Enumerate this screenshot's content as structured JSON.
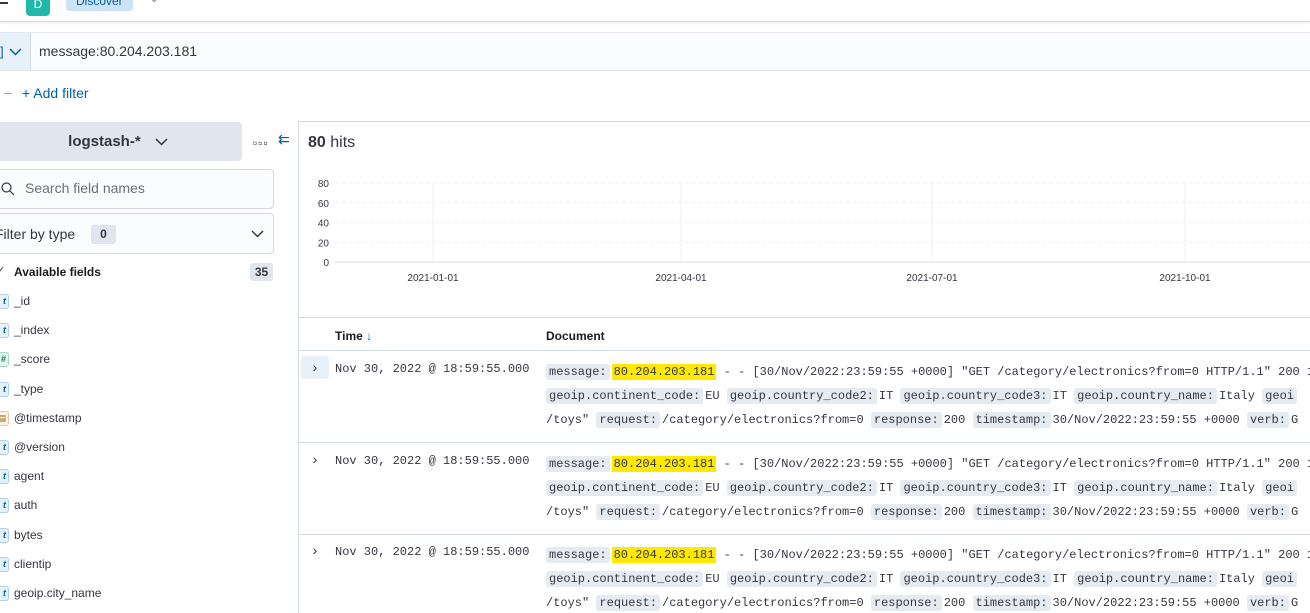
{
  "header": {
    "app_initial": "D",
    "breadcrumb": "Discover"
  },
  "query": {
    "text": "message:80.204.203.181"
  },
  "filters": {
    "add_label": "+ Add filter"
  },
  "sidebar": {
    "index_pattern": "logstash-*",
    "search_placeholder": "Search field names",
    "filter_by_type_label": "Filter by type",
    "filter_by_type_count": "0",
    "available_fields_label": "Available fields",
    "available_fields_count": "35",
    "fields": [
      {
        "name": "_id",
        "type": "t"
      },
      {
        "name": "_index",
        "type": "t"
      },
      {
        "name": "_score",
        "type": "#"
      },
      {
        "name": "_type",
        "type": "t"
      },
      {
        "name": "@timestamp",
        "type": "date"
      },
      {
        "name": "@version",
        "type": "t"
      },
      {
        "name": "agent",
        "type": "t"
      },
      {
        "name": "auth",
        "type": "t"
      },
      {
        "name": "bytes",
        "type": "t"
      },
      {
        "name": "clientip",
        "type": "t"
      },
      {
        "name": "geoip.city_name",
        "type": "t"
      }
    ]
  },
  "main": {
    "hits_count": "80",
    "hits_label": "hits",
    "columns": {
      "time": "Time",
      "time_sort": "↓",
      "document": "Document"
    }
  },
  "chart_data": {
    "type": "bar",
    "y_ticks": [
      "80",
      "60",
      "40",
      "20",
      "0"
    ],
    "ylim": [
      0,
      80
    ],
    "x_ticks": [
      "2021-01-01",
      "2021-04-01",
      "2021-07-01",
      "2021-10-01"
    ],
    "grid": true,
    "values": []
  },
  "rows": [
    {
      "time": "Nov 30, 2022 @ 18:59:55.000",
      "message_key": "message:",
      "message_ip": "80.204.203.181",
      "message_rest": " - - [30/Nov/2022:23:59:55 +0000] \"GET /category/electronics?from=0 HTTP/1.1\" 200 1",
      "continent_key": "geoip.continent_code:",
      "continent_val": "EU",
      "cc2_key": "geoip.country_code2:",
      "cc2_val": "IT",
      "cc3_key": "geoip.country_code3:",
      "cc3_val": "IT",
      "cname_key": "geoip.country_name:",
      "cname_val": "Italy",
      "geo_trail": "geoi",
      "referrer_tail": "/toys\"",
      "request_key": "request:",
      "request_val": "/category/electronics?from=0",
      "response_key": "response:",
      "response_val": "200",
      "timestamp_key": "timestamp:",
      "timestamp_val": "30/Nov/2022:23:59:55 +0000",
      "verb_key": "verb:",
      "verb_val": "G"
    },
    {
      "time": "Nov 30, 2022 @ 18:59:55.000",
      "message_key": "message:",
      "message_ip": "80.204.203.181",
      "message_rest": " - - [30/Nov/2022:23:59:55 +0000] \"GET /category/electronics?from=0 HTTP/1.1\" 200 1",
      "continent_key": "geoip.continent_code:",
      "continent_val": "EU",
      "cc2_key": "geoip.country_code2:",
      "cc2_val": "IT",
      "cc3_key": "geoip.country_code3:",
      "cc3_val": "IT",
      "cname_key": "geoip.country_name:",
      "cname_val": "Italy",
      "geo_trail": "geoi",
      "referrer_tail": "/toys\"",
      "request_key": "request:",
      "request_val": "/category/electronics?from=0",
      "response_key": "response:",
      "response_val": "200",
      "timestamp_key": "timestamp:",
      "timestamp_val": "30/Nov/2022:23:59:55 +0000",
      "verb_key": "verb:",
      "verb_val": "G"
    },
    {
      "time": "Nov 30, 2022 @ 18:59:55.000",
      "message_key": "message:",
      "message_ip": "80.204.203.181",
      "message_rest": " - - [30/Nov/2022:23:59:55 +0000] \"GET /category/electronics?from=0 HTTP/1.1\" 200 1",
      "continent_key": "geoip.continent_code:",
      "continent_val": "EU",
      "cc2_key": "geoip.country_code2:",
      "cc2_val": "IT",
      "cc3_key": "geoip.country_code3:",
      "cc3_val": "IT",
      "cname_key": "geoip.country_name:",
      "cname_val": "Italy",
      "geo_trail": "geoi",
      "referrer_tail": "/toys\"",
      "request_key": "request:",
      "request_val": "/category/electronics?from=0",
      "response_key": "response:",
      "response_val": "200",
      "timestamp_key": "timestamp:",
      "timestamp_val": "30/Nov/2022:23:59:55 +0000",
      "verb_key": "verb:",
      "verb_val": "G"
    }
  ]
}
